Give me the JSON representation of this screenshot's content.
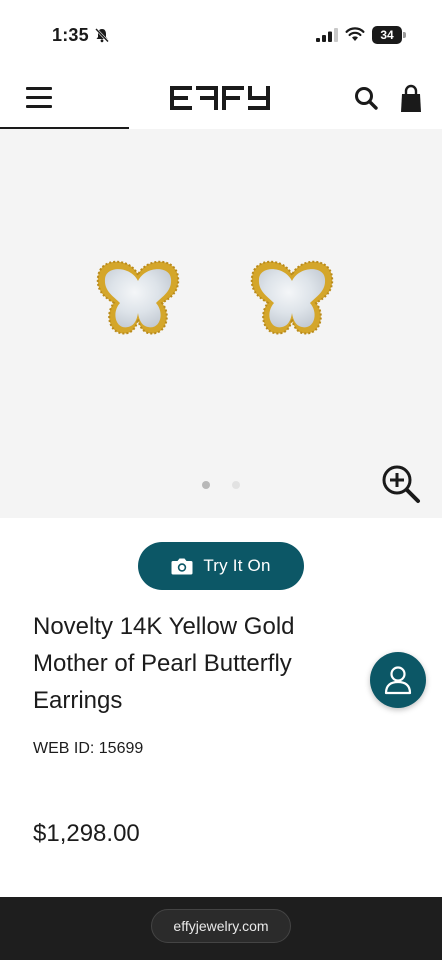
{
  "status_bar": {
    "time": "1:35",
    "battery": "34"
  },
  "header": {
    "logo_text": "EFFY",
    "icons": [
      "menu-icon",
      "search-icon",
      "shopping-bag-icon"
    ]
  },
  "gallery": {
    "image_alt": "Novelty 14K Yellow Gold Mother of Pearl Butterfly Earrings",
    "slide_count": 2,
    "active_slide": 1,
    "zoom_icon": "zoom-in-icon"
  },
  "try_on": {
    "label": "Try It On",
    "icon": "camera-icon"
  },
  "product": {
    "title": "Novelty 14K Yellow Gold Mother of Pearl Butterfly Earrings",
    "web_id": "WEB ID: 15699",
    "price": "$1,298.00"
  },
  "account_button": {
    "icon": "user-icon"
  },
  "browser": {
    "url": "effyjewelry.com"
  },
  "colors": {
    "accent": "#0c5766",
    "gold": "#d4a62a",
    "background_gallery": "#f4f4f4",
    "browser_bar": "#1e1e1e"
  }
}
